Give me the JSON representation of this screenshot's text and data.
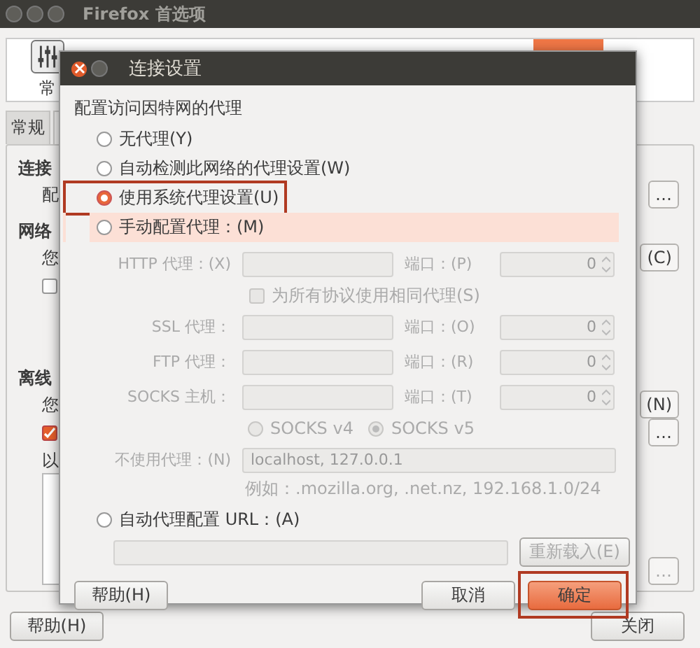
{
  "window": {
    "title": "Firefox 首选项"
  },
  "toolbar": [
    {
      "label": "常",
      "selected": false
    },
    {
      "selected": true
    }
  ],
  "tabs": [
    {
      "label": "常规",
      "selected": false
    }
  ],
  "sections": [
    {
      "heading": "连接",
      "text": "配",
      "button": "…"
    },
    {
      "heading": "网络",
      "text": "您",
      "button": "(C)",
      "checked": false
    },
    {
      "heading": "离线",
      "text": "您",
      "button": "(N)",
      "checked": true,
      "button_2": "…",
      "list_label": "以",
      "button_3": "…"
    }
  ],
  "footer": {
    "help": "帮助(H)",
    "close": "关闭"
  },
  "dialog": {
    "title": "连接设置",
    "heading": "配置访问因特网的代理",
    "modes": [
      {
        "label": "无代理(Y)",
        "selected": false,
        "highlighted": false,
        "hovered": false
      },
      {
        "label": "自动检测此网络的代理设置(W)",
        "selected": false,
        "highlighted": false,
        "hovered": false
      },
      {
        "label": "使用系统代理设置(U)",
        "selected": true,
        "highlighted": true,
        "hovered": false
      },
      {
        "label": "手动配置代理：(M)",
        "selected": false,
        "highlighted": false,
        "hovered": true
      },
      {
        "label": "自动代理配置 URL：(A)",
        "selected": false,
        "highlighted": false,
        "hovered": false
      }
    ],
    "manual": {
      "disabled": true,
      "proxies": [
        {
          "label": "HTTP 代理：(X)",
          "port_label": "端口：(P)",
          "port": "0"
        },
        {
          "label": "SSL 代理：",
          "port_label": "端口：(O)",
          "port": "0"
        },
        {
          "label": "FTP 代理：",
          "port_label": "端口：(R)",
          "port": "0"
        },
        {
          "label": "SOCKS 主机：",
          "port_label": "端口：(T)",
          "port": "0"
        }
      ],
      "same_proxy": {
        "label": "为所有协议使用相同代理(S)",
        "checked": false
      },
      "socks_versions": [
        {
          "label": "SOCKS v4",
          "selected": false
        },
        {
          "label": "SOCKS v5",
          "selected": true
        }
      ],
      "no_proxy": {
        "label": "不使用代理：(N)",
        "value": "localhost, 127.0.0.1"
      },
      "example": "例如：.mozilla.org, .net.nz, 192.168.1.0/24"
    },
    "reload": "重新载入(E)",
    "buttons": {
      "help": "帮助(H)",
      "cancel": "取消",
      "ok": "确定",
      "ok_highlighted": true
    }
  }
}
